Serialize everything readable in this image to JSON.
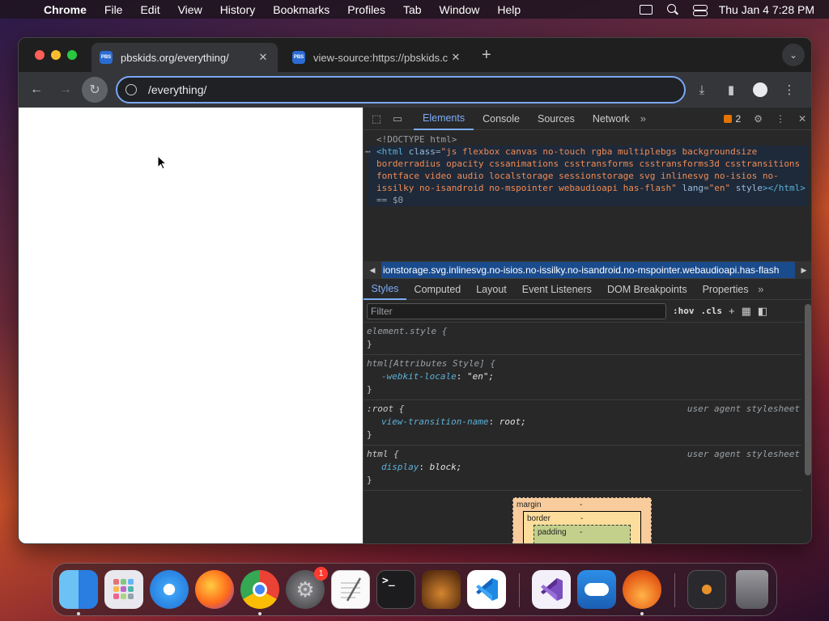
{
  "menubar": {
    "app_name": "Chrome",
    "items": [
      "File",
      "Edit",
      "View",
      "History",
      "Bookmarks",
      "Profiles",
      "Tab",
      "Window",
      "Help"
    ],
    "clock": "Thu Jan 4  7:28 PM"
  },
  "browser": {
    "tabs": [
      {
        "title": "pbskids.org/everything/",
        "favicon": "PBS KIDS"
      },
      {
        "title": "view-source:https://pbskids.c",
        "favicon": "PBS KIDS"
      }
    ],
    "new_tab_label": "+",
    "url": "/everything/"
  },
  "devtools": {
    "tabs": [
      "Elements",
      "Console",
      "Sources",
      "Network"
    ],
    "active_tab": "Elements",
    "issues_count": "2",
    "dom": {
      "doctype": "<!DOCTYPE html>",
      "html_open": "<html",
      "class_attr": "class",
      "class_value": "\"js flexbox canvas no-touch rgba multiplebgs backgroundsize borderradius opacity cssanimations csstransforms csstransforms3d csstransitions fontface video audio localstorage sessionstorage svg inlinesvg no-isios no-issilky no-isandroid no-mspointer webaudioapi has-flash\"",
      "lang_attr": "lang",
      "lang_value": "\"en\"",
      "style_attr": "style",
      "html_close": "></html>",
      "selected_marker": "== $0"
    },
    "breadcrumb": "ionstorage.svg.inlinesvg.no-isios.no-issilky.no-isandroid.no-mspointer.webaudioapi.has-flash",
    "sub_tabs": [
      "Styles",
      "Computed",
      "Layout",
      "Event Listeners",
      "DOM Breakpoints",
      "Properties"
    ],
    "active_sub_tab": "Styles",
    "filter_placeholder": "Filter",
    "hov_label": ":hov",
    "cls_label": ".cls",
    "rules": [
      {
        "selector": "element.style {",
        "origin": "",
        "props": [],
        "close": "}"
      },
      {
        "selector": "html[Attributes Style] {",
        "origin": "",
        "props": [
          {
            "name": "-webkit-locale",
            "value": "\"en\";"
          }
        ],
        "close": "}"
      },
      {
        "selector": ":root {",
        "origin": "user agent stylesheet",
        "props": [
          {
            "name": "view-transition-name",
            "value": "root;"
          }
        ],
        "close": "}"
      },
      {
        "selector": "html {",
        "origin": "user agent stylesheet",
        "props": [
          {
            "name": "display",
            "value": "block;"
          }
        ],
        "close": "}"
      }
    ],
    "box_model": {
      "margin": "margin",
      "border": "border",
      "padding": "padding",
      "dash": "-"
    }
  },
  "dock": {
    "apps": [
      "Finder",
      "Launchpad",
      "Safari",
      "Firefox",
      "Chrome",
      "System Settings",
      "TextEdit",
      "Terminal",
      "GarageBand",
      "Visual Studio Code",
      "Visual Studio",
      "Weather",
      "Fluid",
      "Downloads",
      "Trash"
    ],
    "settings_badge": "1"
  },
  "colors": {
    "accent": "#7cacf8",
    "tab_active": "#35363a",
    "selection": "#1a4b8c"
  }
}
